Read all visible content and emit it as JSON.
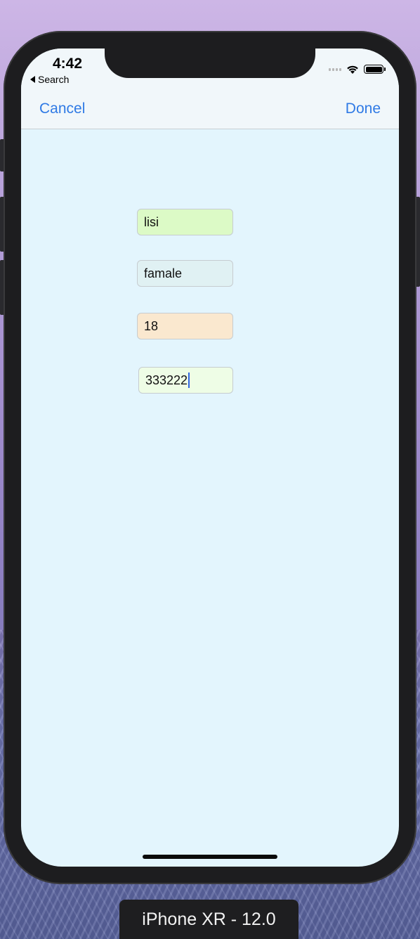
{
  "status_bar": {
    "time": "4:42",
    "back_label": "Search"
  },
  "navbar": {
    "cancel_label": "Cancel",
    "done_label": "Done"
  },
  "form": {
    "name_value": "lisi",
    "gender_value": "famale",
    "age_value": "18",
    "phone_value": "333222"
  },
  "simulator": {
    "device_label": "iPhone XR - 12.0"
  },
  "colors": {
    "accent": "#2f7ae5",
    "screen_bg": "#e3f5fd",
    "name_field_bg": "#dcfac6",
    "gender_field_bg": "#e0f1f3",
    "age_field_bg": "#fae8cf",
    "phone_field_bg": "#eefde6"
  }
}
